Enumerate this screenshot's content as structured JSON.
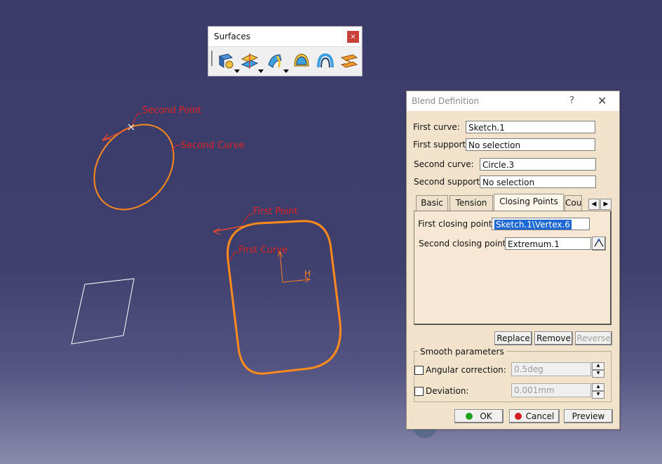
{
  "toolbar": {
    "title": "Surfaces",
    "close_symbol": "×",
    "icons": [
      "extrude-surface-icon",
      "offset-surface-icon",
      "sweep-surface-icon",
      "fill-surface-icon",
      "multi-section-surface-icon",
      "blend-surface-icon"
    ]
  },
  "viewport": {
    "labels": {
      "second_point": "Second Point",
      "second_curve": "Second Curve",
      "first_point": "First Point",
      "first_curve": "First Curve",
      "axis_h": "H"
    },
    "colors": {
      "curve": "#ff8a1c",
      "label": "#e0231f",
      "wire": "#ffffff"
    }
  },
  "dialog": {
    "title": "Blend Definition",
    "help": "?",
    "close": "✕",
    "first_curve_label": "First curve:",
    "first_curve_value": "Sketch.1",
    "first_support_label": "First support:",
    "first_support_value": "No selection",
    "second_curve_label": "Second curve:",
    "second_curve_value": "Circle.3",
    "second_support_label": "Second support:",
    "second_support_value": "No selection",
    "tabs": [
      "Basic",
      "Tension",
      "Closing Points",
      "Cou"
    ],
    "active_tab": "Closing Points",
    "first_closing_label": "First closing point:",
    "first_closing_value": "Sketch.1\\Vertex.6",
    "second_closing_label": "Second closing point:",
    "second_closing_value": "Extremum.1",
    "buttons": {
      "replace": "Replace",
      "remove": "Remove",
      "reverse": "Reverse"
    },
    "smooth_title": "Smooth parameters",
    "angular_label": "Angular correction:",
    "angular_value": "0.5deg",
    "deviation_label": "Deviation:",
    "deviation_value": "0.001mm",
    "ok": "OK",
    "cancel": "Cancel",
    "preview": "Preview"
  }
}
